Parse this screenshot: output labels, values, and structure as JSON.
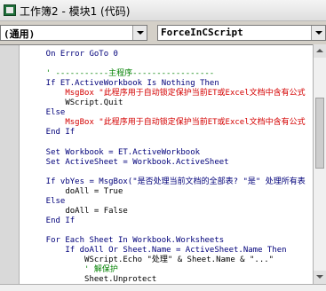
{
  "window": {
    "title": "工作簿2 - 模块1 (代码)"
  },
  "selectors": {
    "object_value": "(通用)",
    "procedure_value": "ForceInCScript"
  },
  "code": {
    "lines": [
      "    On Error GoTo 0",
      "",
      "    ' -----------主程序-----------------",
      "    If ET.ActiveWorkbook Is Nothing Then",
      "        MsgBox \"此程序用于自动锁定保护当前ET或Excel文档中含有公式",
      "        WScript.Quit",
      "    Else",
      "        MsgBox \"此程序用于自动锁定保护当前ET或Excel文档中含有公式",
      "    End If",
      "",
      "    Set Workbook = ET.ActiveWorkbook",
      "    Set ActiveSheet = Workbook.ActiveSheet",
      "",
      "    If vbYes = MsgBox(\"是否处理当前文档的全部表? \"是\" 处理所有表",
      "        doAll = True",
      "    Else",
      "        doAll = False",
      "    End If",
      "",
      "    For Each Sheet In Workbook.Worksheets",
      "        If doAll Or Sheet.Name = ActiveSheet.Name Then",
      "            WScript.Echo \"处理\" & Sheet.Name & \"...\"",
      "            ' 解保护",
      "            Sheet.Unprotect"
    ]
  },
  "colors": {
    "keyword": "#00007a",
    "comment": "#008000",
    "string": "#a31515",
    "error": "#d40000"
  }
}
